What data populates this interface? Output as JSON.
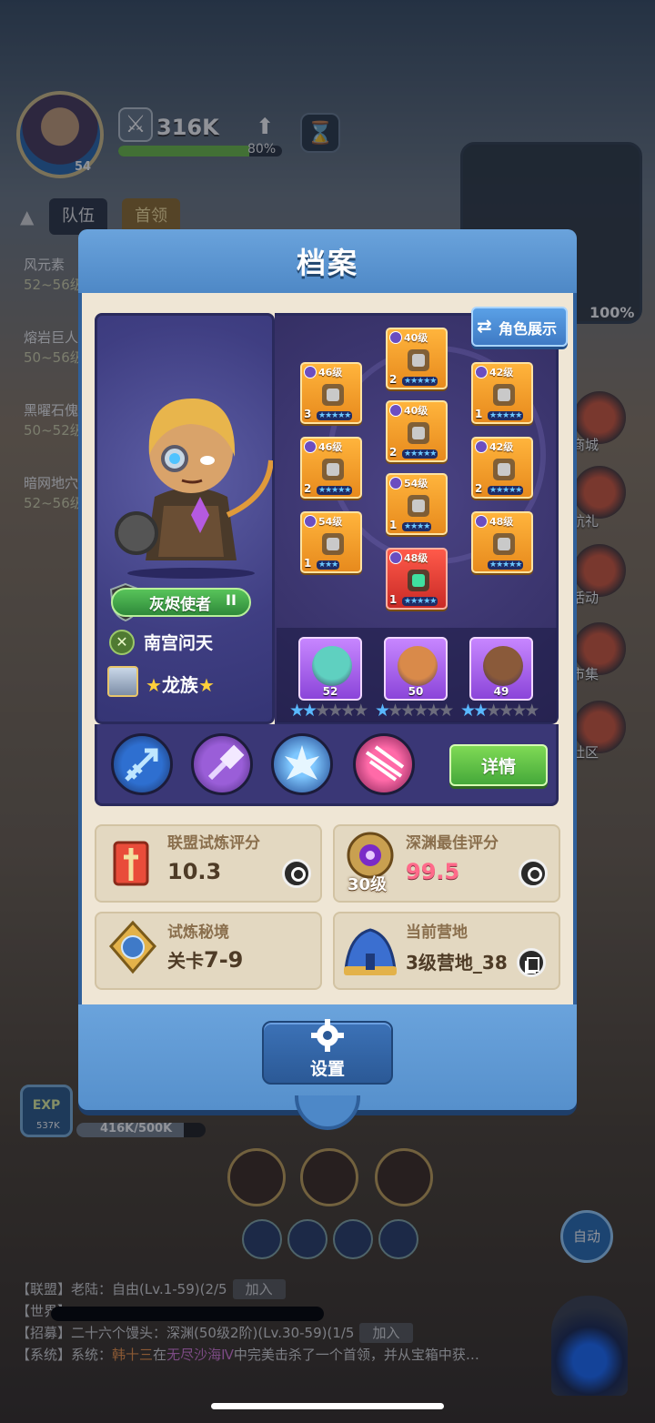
{
  "hud": {
    "player_level": "54",
    "power": "316K",
    "power_progress_pct": 80,
    "power_progress_text": "80%",
    "tabs": [
      "队伍",
      "首领"
    ],
    "quests": [
      {
        "name": "风元素",
        "range": "52~56级"
      },
      {
        "name": "熔岩巨人",
        "range": "50~56级"
      },
      {
        "name": "黑曜石傀",
        "range": "50~52级"
      },
      {
        "name": "暗网地穴",
        "range": "52~56级"
      }
    ],
    "minimap_pct": "100%",
    "side_buttons": [
      "商城",
      "航礼",
      "活动",
      "市集",
      "社区"
    ],
    "exp_label": "EXP",
    "exp_amount": "537K",
    "exp_progress": "416K/500K",
    "exp_fraction": 0.832,
    "auto_label": "自动",
    "chat": [
      {
        "channel": "【联盟】",
        "text": "老陆：自由(Lv.1-59)(2/5",
        "join": "加入"
      },
      {
        "channel": "【世界】",
        "text": "",
        "join": ""
      },
      {
        "channel": "【招募】",
        "text": "二十六个馒头：深渊(50级2阶)(Lv.30-59)(1/5",
        "join": "加入"
      },
      {
        "channel": "【系统】",
        "prefix": "系统：",
        "name": "韩十三",
        "mid": "在",
        "loc": "无尽沙海Ⅳ",
        "suffix": "中完美击杀了一个首领，并从宝箱中获…"
      }
    ]
  },
  "modal": {
    "title": "档案",
    "showcase_button": "角色展示",
    "hero": {
      "title_badge": "灰烬使者",
      "title_rank": "II",
      "name": "南宫问天",
      "clan_prefix": "★",
      "clan": "龙族",
      "clan_suffix": "★"
    },
    "equipment": [
      {
        "level": "46级",
        "count": "3",
        "stars": "★★★★★",
        "color": "orange",
        "art": "crossbow"
      },
      {
        "level": "40级",
        "count": "2",
        "stars": "★★★★★",
        "color": "orange",
        "art": "glove"
      },
      {
        "level": "42级",
        "count": "1",
        "stars": "★★★★★",
        "color": "orange",
        "art": "arm"
      },
      {
        "level": "46级",
        "count": "2",
        "stars": "★★★★★",
        "color": "orange",
        "art": "gauntlet"
      },
      {
        "level": "40级",
        "count": "2",
        "stars": "★★★★★",
        "color": "orange",
        "art": "boots"
      },
      {
        "level": "42级",
        "count": "2",
        "stars": "★★★★★",
        "color": "orange",
        "art": "chest"
      },
      {
        "level": "54级",
        "count": "1",
        "stars": "★★★",
        "color": "orange",
        "art": "ring"
      },
      {
        "level": "54级",
        "count": "1",
        "stars": "★★★★",
        "color": "orange",
        "art": "chain"
      },
      {
        "level": "48级",
        "count": "",
        "stars": "★★★★★",
        "color": "orange",
        "art": "bag"
      },
      {
        "level": "48级",
        "count": "1",
        "stars": "★★★★★",
        "color": "red",
        "art": "cloak"
      }
    ],
    "pets": [
      {
        "level": "52",
        "stars_on": 2,
        "stars_total": 6,
        "color": "#5fd0c0"
      },
      {
        "level": "50",
        "stars_on": 1,
        "stars_total": 6,
        "color": "#d98a4a"
      },
      {
        "level": "49",
        "stars_on": 2,
        "stars_total": 6,
        "color": "#8a5a3a"
      }
    ],
    "skills": [
      "arrow-skill-icon",
      "hammer-skill-icon",
      "frost-skill-icon",
      "slash-skill-icon"
    ],
    "detail_button": "详情",
    "stats": {
      "alliance_trial": {
        "title": "联盟试炼评分",
        "value": "10.3"
      },
      "abyss_best": {
        "title": "深渊最佳评分",
        "value": "99.5",
        "sub": "30级"
      },
      "trial_realm": {
        "title": "试炼秘境",
        "value_prefix": "关卡",
        "value": "7-9"
      },
      "current_camp": {
        "title": "当前营地",
        "value": "3级营地_38"
      }
    },
    "settings_button": "设置"
  },
  "colors": {
    "panel_blue": "#4d88c8",
    "body_beige": "#efe6d5",
    "hero_purple": "#3f3e82",
    "equip_orange": "#e78a1d",
    "detail_green": "#45a83a",
    "score_pink": "#ff6a8a"
  }
}
